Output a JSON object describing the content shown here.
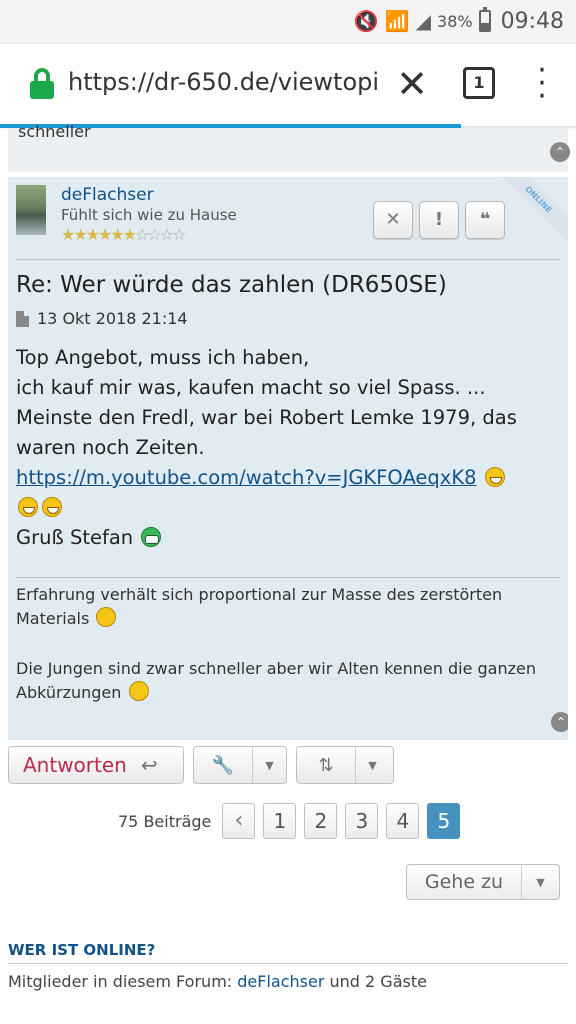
{
  "status_bar": {
    "battery_pct": "38%",
    "battery_level": 0.38,
    "time": "09:48"
  },
  "browser": {
    "url_main": "https://dr-650.de/viewtopi",
    "url_fade": "c",
    "tab_count": "1",
    "load_progress": 0.8
  },
  "prev_post": {
    "tail_text": "schneller"
  },
  "post": {
    "author": "deFlachser",
    "rank": "Fühlt sich wie zu Hause",
    "stars_total": 10,
    "stars_filled": 6,
    "online_label": "ONLINE",
    "title": "Re: Wer würde das zahlen (DR650SE)",
    "date": "13 Okt 2018 21:14",
    "body_line1": "Top Angebot, muss ich haben,",
    "body_line2": "ich kauf mir was, kaufen macht so viel Spass. ...",
    "body_line3": "Meinste den Fredl, war bei Robert Lemke 1979, das waren noch Zeiten.",
    "link": "https://m.youtube.com/watch?v=JGKFOAeqxK8",
    "greeting": "Gruß Stefan",
    "signature_1": "Erfahrung verhält sich proportional zur Masse des zerstörten Materials",
    "signature_2": "Die Jungen sind zwar schneller aber wir Alten kennen die ganzen Abkürzungen"
  },
  "actions": {
    "reply_label": "Antworten"
  },
  "pagination": {
    "count_label": "75 Beiträge",
    "pages": [
      "1",
      "2",
      "3",
      "4",
      "5"
    ],
    "current": "5"
  },
  "jump": {
    "label": "Gehe zu"
  },
  "online": {
    "heading": "WER IST ONLINE?",
    "prefix": "Mitglieder in diesem Forum:",
    "member": "deFlachser",
    "suffix": "und 2 Gäste"
  }
}
